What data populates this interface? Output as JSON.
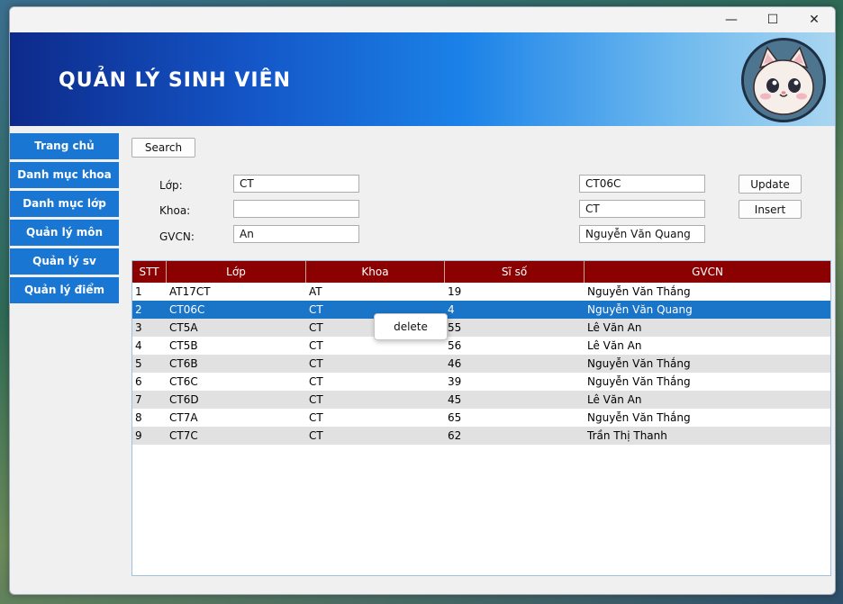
{
  "app": {
    "title": "QUẢN LÝ SINH VIÊN"
  },
  "window_controls": {
    "minimize": "—",
    "maximize": "☐",
    "close": "✕"
  },
  "sidebar": {
    "items": [
      {
        "label": "Trang chủ"
      },
      {
        "label": "Danh mục khoa"
      },
      {
        "label": "Danh mục lớp"
      },
      {
        "label": "Quản lý môn"
      },
      {
        "label": "Quản lý sv"
      },
      {
        "label": "Quản lý điểm"
      }
    ]
  },
  "toolbar": {
    "search_label": "Search",
    "update_label": "Update",
    "insert_label": "Insert"
  },
  "form": {
    "lop_label": "Lớp:",
    "lop_value": "CT",
    "khoa_label": "Khoa:",
    "khoa_value": "",
    "gvcn_label": "GVCN:",
    "gvcn_value": "An",
    "right_lop_value": "CT06C",
    "right_khoa_value": "CT",
    "right_gvcn_value": "Nguyễn Văn Quang"
  },
  "table": {
    "headers": [
      "STT",
      "Lớp",
      "Khoa",
      "Sĩ số",
      "GVCN"
    ],
    "rows": [
      [
        "1",
        "AT17CT",
        "AT",
        "19",
        "Nguyễn Văn Thắng"
      ],
      [
        "2",
        "CT06C",
        "CT",
        "4",
        "Nguyễn Văn Quang"
      ],
      [
        "3",
        "CT5A",
        "CT",
        "55",
        "Lê Văn An"
      ],
      [
        "4",
        "CT5B",
        "CT",
        "56",
        "Lê Văn An"
      ],
      [
        "5",
        "CT6B",
        "CT",
        "46",
        "Nguyễn Văn Thắng"
      ],
      [
        "6",
        "CT6C",
        "CT",
        "39",
        "Nguyễn Văn Thắng"
      ],
      [
        "7",
        "CT6D",
        "CT",
        "45",
        "Lê Văn An"
      ],
      [
        "8",
        "CT7A",
        "CT",
        "65",
        "Nguyễn Văn Thắng"
      ],
      [
        "9",
        "CT7C",
        "CT",
        "62",
        "Trần Thị Thanh"
      ]
    ],
    "selected_row": 1
  },
  "context_menu": {
    "items": [
      {
        "label": "delete"
      }
    ]
  },
  "colors": {
    "header_bg": "#8b0000",
    "sidebar_bg": "#1976d2",
    "selection_bg": "#1a74c8"
  }
}
